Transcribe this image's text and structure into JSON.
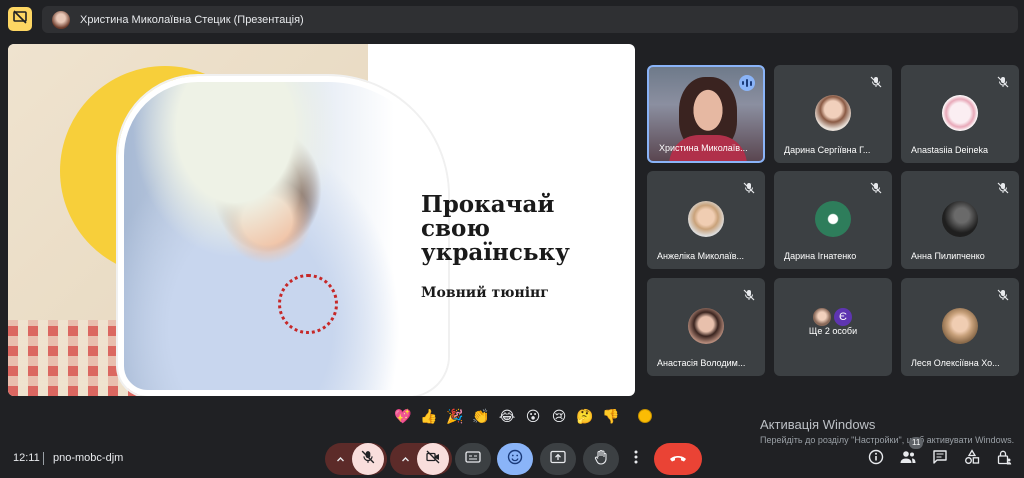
{
  "presenter_bar": {
    "label": "Христина Миколаївна Стецик (Презентація)"
  },
  "slide": {
    "title_line1": "Прокачай",
    "title_line2": "свою",
    "title_line3": "українську",
    "subtitle": "Мовний тюнінг"
  },
  "participants": [
    {
      "name": "Христина Миколаїв...",
      "video": true,
      "speaking": true
    },
    {
      "name": "Дарина Сергіївна Г...",
      "muted": true,
      "avatar_color": "#b08d7a"
    },
    {
      "name": "Anastasiia Deineka",
      "muted": true,
      "avatar_color": "#f0e6ea"
    },
    {
      "name": "Анжеліка Миколаїв...",
      "muted": true,
      "avatar_color": "#c9a27a"
    },
    {
      "name": "Дарина Ігнатенко",
      "muted": true,
      "avatar_color": "#2e7d5b"
    },
    {
      "name": "Анна Пилипченко",
      "muted": true,
      "avatar_color": "#3a3a3a"
    },
    {
      "name": "Анастасія Володим...",
      "muted": true,
      "avatar_color": "#b58b7b"
    },
    {
      "name": "Ще 2 особи",
      "more_initial": "Є"
    },
    {
      "name": "Леся Олексіївна Хо...",
      "muted": true,
      "avatar_color": "#c7a07a"
    }
  ],
  "reactions": [
    "💖",
    "👍",
    "🎉",
    "👏",
    "😂",
    "😮",
    "😢",
    "🤔",
    "👎"
  ],
  "meeting": {
    "time": "12:11",
    "code": "pno-mobc-djm"
  },
  "participants_count": "11",
  "windows_activation": {
    "title": "Активація Windows",
    "body": "Перейдіть до розділу \"Настройки\", щоб активувати Windows."
  },
  "colors": {
    "background": "#202124",
    "tile": "#3c4043",
    "accent_blue": "#8ab4f8",
    "hangup_red": "#ea4335",
    "present_yellow": "#fdd663"
  }
}
